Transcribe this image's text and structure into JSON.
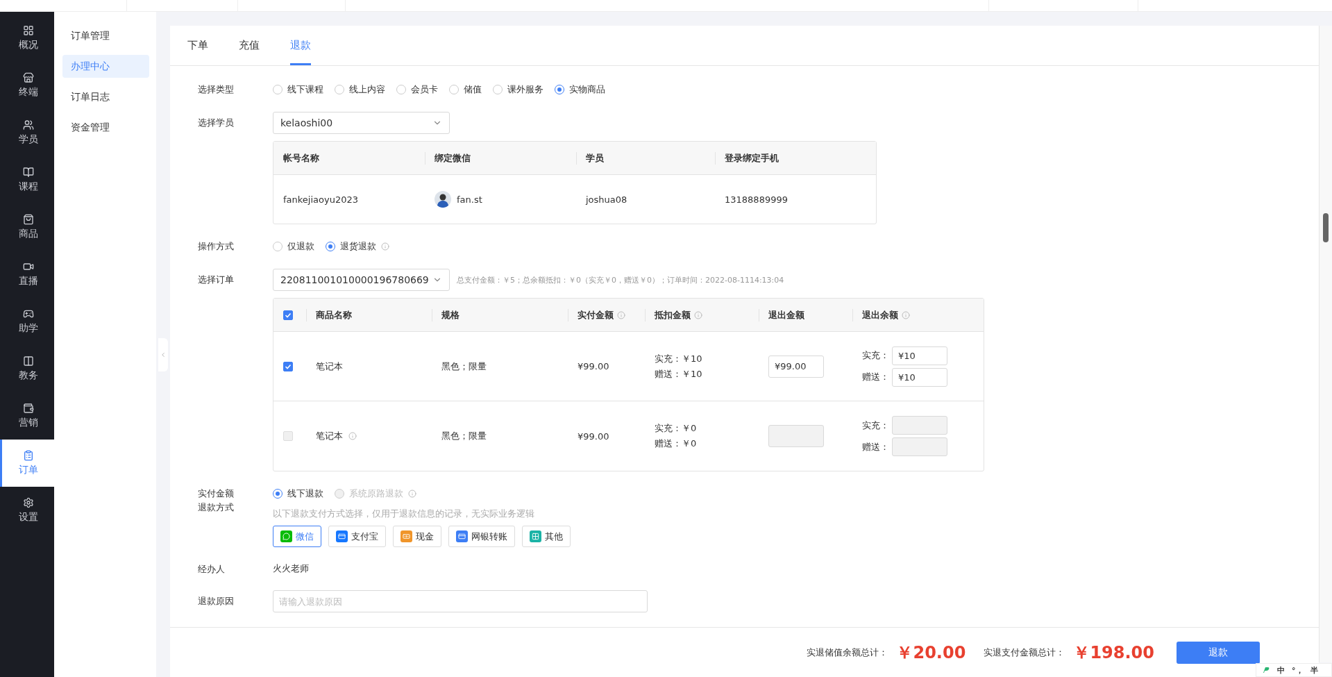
{
  "main_nav": [
    {
      "label": "概况",
      "selected": false
    },
    {
      "label": "终端",
      "selected": false
    },
    {
      "label": "学员",
      "selected": false
    },
    {
      "label": "课程",
      "selected": false
    },
    {
      "label": "商品",
      "selected": false
    },
    {
      "label": "直播",
      "selected": false
    },
    {
      "label": "助学",
      "selected": false
    },
    {
      "label": "教务",
      "selected": false
    },
    {
      "label": "营销",
      "selected": false
    },
    {
      "label": "订单",
      "selected": true
    },
    {
      "label": "设置",
      "selected": false
    }
  ],
  "sub_nav": [
    {
      "label": "订单管理",
      "selected": false
    },
    {
      "label": "办理中心",
      "selected": true
    },
    {
      "label": "订单日志",
      "selected": false
    },
    {
      "label": "资金管理",
      "selected": false
    }
  ],
  "tabs": [
    {
      "label": "下单",
      "selected": false
    },
    {
      "label": "充值",
      "selected": false
    },
    {
      "label": "退款",
      "selected": true
    }
  ],
  "type_row": {
    "label": "选择类型",
    "options": [
      {
        "label": "线下课程",
        "selected": false
      },
      {
        "label": "线上内容",
        "selected": false
      },
      {
        "label": "会员卡",
        "selected": false
      },
      {
        "label": "储值",
        "selected": false
      },
      {
        "label": "课外服务",
        "selected": false
      },
      {
        "label": "实物商品",
        "selected": true
      }
    ]
  },
  "student_row": {
    "label": "选择学员",
    "value": "kelaoshi00"
  },
  "account_table": {
    "columns": [
      "帐号名称",
      "绑定微信",
      "学员",
      "登录绑定手机"
    ],
    "rows": [
      {
        "account": "fankejiaoyu2023",
        "wechat": "fan.st",
        "student": "joshua08",
        "phone": "13188889999"
      }
    ]
  },
  "operation_row": {
    "label": "操作方式",
    "options": [
      {
        "label": "仅退款",
        "selected": false,
        "info": false
      },
      {
        "label": "退货退款",
        "selected": true,
        "info": true
      }
    ]
  },
  "order_row": {
    "label": "选择订单",
    "value": "220811001010000196780669",
    "summary": "总支付金额：￥5；总余额抵扣：￥0（实充￥0，赠送￥0）；订单时间：2022-08-1114:13:04"
  },
  "product_table": {
    "all_checked": true,
    "columns": [
      {
        "label": "商品名称",
        "info": false
      },
      {
        "label": "规格",
        "info": false
      },
      {
        "label": "实付金额",
        "info": true
      },
      {
        "label": "抵扣金额",
        "info": true
      },
      {
        "label": "退出金额",
        "info": false
      },
      {
        "label": "退出余额",
        "info": true
      }
    ],
    "rows": [
      {
        "checked": true,
        "disabled": false,
        "name": "笔记本",
        "name_info": false,
        "spec": "黑色；限量",
        "paid": "¥99.00",
        "deduction": [
          "实充：￥10",
          "赠送：￥10"
        ],
        "refund_amount": "¥99.00",
        "balance": [
          {
            "label": "实充：",
            "value": "¥10"
          },
          {
            "label": "赠送：",
            "value": "¥10"
          }
        ]
      },
      {
        "checked": false,
        "disabled": true,
        "name": "笔记本",
        "name_info": true,
        "spec": "黑色；限量",
        "paid": "¥99.00",
        "deduction": [
          "实充：￥0",
          "赠送：￥0"
        ],
        "balance": [
          {
            "label": "实充："
          },
          {
            "label": "赠送："
          }
        ]
      }
    ]
  },
  "refund_method": {
    "label_lines": [
      "实付金额",
      "退款方式"
    ],
    "options": [
      {
        "label": "线下退款",
        "selected": true,
        "disabled": false,
        "info": false
      },
      {
        "label": "系统原路退款",
        "selected": false,
        "disabled": true,
        "info": true
      }
    ],
    "hint": "以下退款支付方式选择，仅用于退款信息的记录，无实际业务逻辑",
    "methods": [
      {
        "label": "微信",
        "kind": "wechat",
        "selected": true
      },
      {
        "label": "支付宝",
        "kind": "alipay",
        "selected": false
      },
      {
        "label": "现金",
        "kind": "cash",
        "selected": false
      },
      {
        "label": "网银转账",
        "kind": "bank",
        "selected": false
      },
      {
        "label": "其他",
        "kind": "other",
        "selected": false
      }
    ]
  },
  "handler_row": {
    "label": "经办人",
    "value": "火火老师"
  },
  "reason_row": {
    "label": "退款原因",
    "placeholder": "请输入退款原因"
  },
  "footer": {
    "totals": [
      {
        "label": "实退储值余额总计：",
        "amount": "￥20.00"
      },
      {
        "label": "实退支付金额总计：",
        "amount": "￥198.00"
      }
    ],
    "button": "退款"
  },
  "ime_bar": {
    "items": [
      "中",
      "°，",
      "半"
    ]
  }
}
